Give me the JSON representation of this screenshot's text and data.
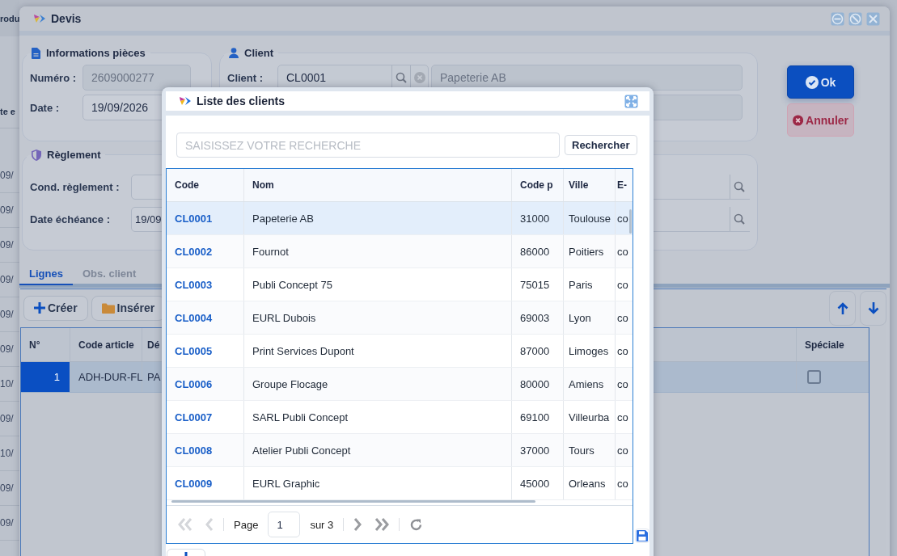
{
  "background_app": {
    "title_fragment": "rodu",
    "column_fragment": "te e",
    "dates": [
      "09/",
      "09/",
      "09/",
      "09/",
      "09/",
      "09/",
      "10/",
      "09/",
      "10/",
      "09/",
      "09/"
    ]
  },
  "window": {
    "title": "Devis"
  },
  "pieces": {
    "legend": "Informations pièces",
    "numero_label": "Numéro :",
    "numero": "2609000277",
    "date_label": "Date :",
    "date": "19/09/2026"
  },
  "client": {
    "legend": "Client",
    "label": "Client :",
    "code": "CL0001",
    "name": "Papeterie AB"
  },
  "reglement": {
    "legend": "Règlement",
    "cond_label": "Cond. règlement :",
    "echeance_label": "Date échéance :",
    "echeance": "19/09"
  },
  "actions": [
    {
      "label": "Ok",
      "kind": "primary"
    },
    {
      "label": "Annuler",
      "kind": "cancel"
    }
  ],
  "tabs": [
    {
      "label": "Lignes",
      "selected": true
    },
    {
      "label": "Obs. client",
      "selected": false
    }
  ],
  "toolbar": [
    {
      "label": "Créer",
      "kind": "create"
    },
    {
      "label": "Insérer",
      "kind": "insert"
    }
  ],
  "lines": {
    "columns": [
      "N°",
      "Code article",
      "Dé",
      "Spéciale"
    ],
    "rows": [
      {
        "n": "1",
        "code": "ADH-DUR-FL",
        "designation": "PA",
        "speciale": false,
        "selected": true
      }
    ]
  },
  "modal": {
    "title": "Liste des clients",
    "search_placeholder": "SAISISSEZ VOTRE RECHERCHE",
    "search_button": "Rechercher",
    "columns": [
      "Code",
      "Nom",
      "Code p",
      "Ville",
      "E-"
    ],
    "rows": [
      {
        "code": "CL0001",
        "nom": "Papeterie AB",
        "cp": "31000",
        "ville": "Toulouse",
        "email": "co",
        "selected": true
      },
      {
        "code": "CL0002",
        "nom": "Fournot",
        "cp": "86000",
        "ville": "Poitiers",
        "email": "co",
        "selected": false
      },
      {
        "code": "CL0003",
        "nom": "Publi Concept 75",
        "cp": "75015",
        "ville": "Paris",
        "email": "co",
        "selected": false
      },
      {
        "code": "CL0004",
        "nom": "EURL Dubois",
        "cp": "69003",
        "ville": "Lyon",
        "email": "co",
        "selected": false
      },
      {
        "code": "CL0005",
        "nom": "Print Services Dupont",
        "cp": "87000",
        "ville": "Limoges",
        "email": "co",
        "selected": false
      },
      {
        "code": "CL0006",
        "nom": "Groupe Flocage",
        "cp": "80000",
        "ville": "Amiens",
        "email": "co",
        "selected": false
      },
      {
        "code": "CL0007",
        "nom": "SARL Publi Concept",
        "cp": "69100",
        "ville": "Villeurba",
        "email": "co",
        "selected": false
      },
      {
        "code": "CL0008",
        "nom": "Atelier Publi Concept",
        "cp": "37000",
        "ville": "Tours",
        "email": "co",
        "selected": false
      },
      {
        "code": "CL0009",
        "nom": "EURL Graphic",
        "cp": "45000",
        "ville": "Orleans",
        "email": "co",
        "selected": false
      }
    ],
    "pager": {
      "page_label": "Page",
      "page": "1",
      "total": "sur 3"
    }
  }
}
